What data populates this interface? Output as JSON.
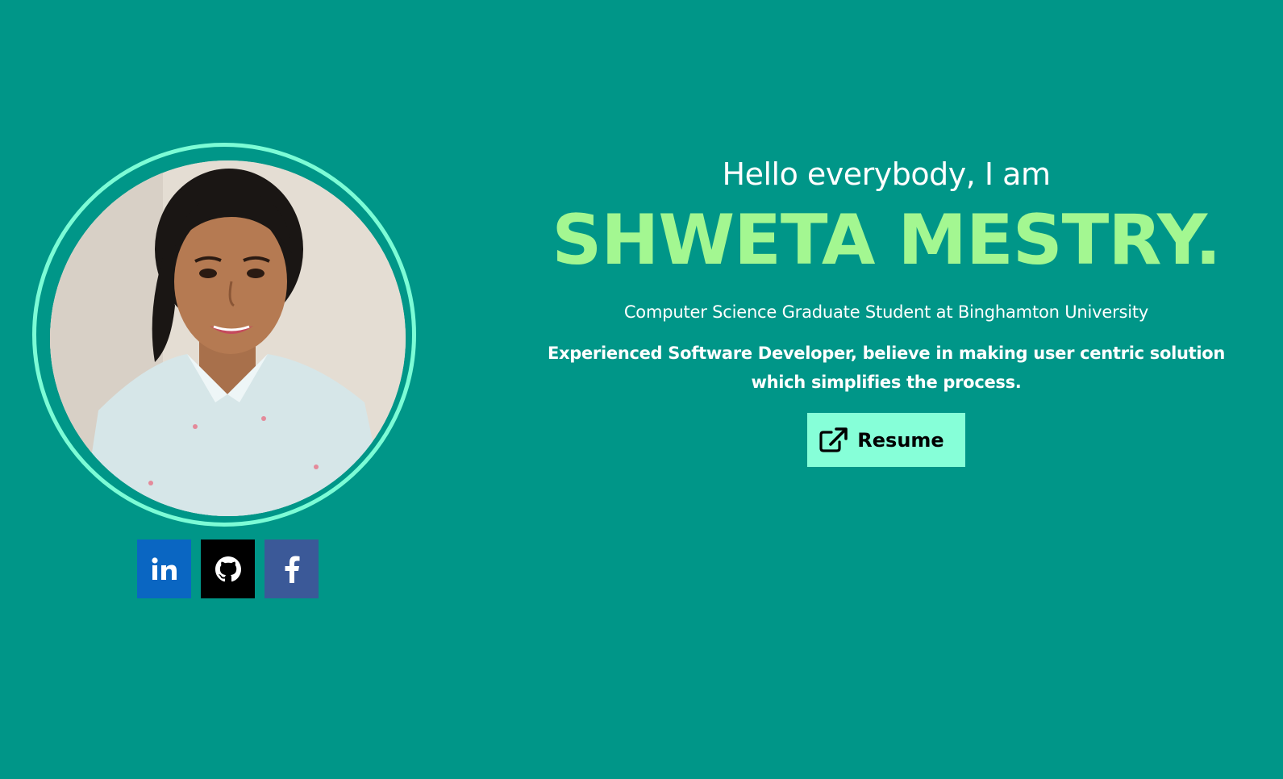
{
  "hero": {
    "greeting": "Hello everybody, I am",
    "name": "SHWETA MESTRY.",
    "subtitle": "Computer Science Graduate Student at Binghamton University",
    "tagline": "Experienced Software Developer, believe in making user centric solution which simplifies the process.",
    "resume_label": "Resume",
    "resume_icon": "external-link-icon"
  },
  "profile": {
    "photo": "profile-photo"
  },
  "social": [
    {
      "name": "linkedin",
      "icon": "linkedin-icon",
      "color": "#0a66c2"
    },
    {
      "name": "github",
      "icon": "github-icon",
      "color": "#000000"
    },
    {
      "name": "facebook",
      "icon": "facebook-icon",
      "color": "#3b5998"
    }
  ],
  "colors": {
    "background": "#009688",
    "name_accent": "#a3f791",
    "ring": "#7cfcd6",
    "resume_button": "#86ffd8"
  }
}
